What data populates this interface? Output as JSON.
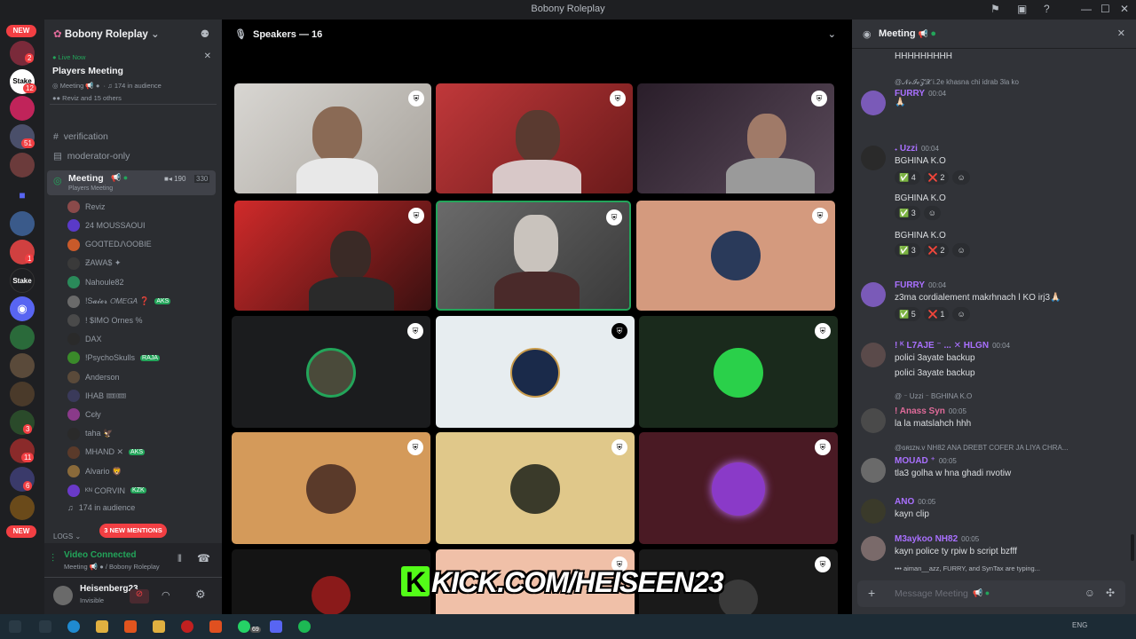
{
  "window": {
    "title": "Bobony Roleplay"
  },
  "sidebar": {
    "new_top": "NEW",
    "new_bottom": "NEW",
    "badges": [
      "2",
      "12",
      "51",
      "1",
      "3",
      "11",
      "6"
    ]
  },
  "guild": {
    "name": "Bobony Roleplay"
  },
  "live": {
    "status": "Live Now",
    "title": "Players Meeting",
    "channel": "Meeting",
    "audience": "174 in audience",
    "others": "Reviz and 15 others"
  },
  "channels": {
    "verification": "verification",
    "moderator_only": "moderator-only",
    "meeting": "Meeting",
    "meeting_sub": "Players Meeting",
    "count_a": "190",
    "count_b": "330",
    "logs": "LOGS",
    "mentions": "3 NEW MENTIONS",
    "audience": "174 in audience"
  },
  "voice_users": [
    {
      "name": "Reviz",
      "tag": ""
    },
    {
      "name": "24 MOUSSAOUI",
      "tag": ""
    },
    {
      "name": "GOⱭTEDᏁOOBIE",
      "tag": ""
    },
    {
      "name": "ƵAWA$ ✦",
      "tag": ""
    },
    {
      "name": "Nahoule82",
      "tag": ""
    },
    {
      "name": "!S𝓪𝓲𝓮𝓻 𝘖𝘔𝘌𝘎𝘈 ❓",
      "tag": "AKS"
    },
    {
      "name": "! $IMO Ornes %",
      "tag": ""
    },
    {
      "name": "DAX",
      "tag": ""
    },
    {
      "name": "!PsychoSkulls",
      "tag": "RAJA"
    },
    {
      "name": "Anderson",
      "tag": ""
    },
    {
      "name": "IHAB 🎟🎟",
      "tag": ""
    },
    {
      "name": "Cєły",
      "tag": ""
    },
    {
      "name": "taha 🦅",
      "tag": ""
    },
    {
      "name": "MHAND ✕",
      "tag": "AKS"
    },
    {
      "name": "Alvario 🦁",
      "tag": ""
    },
    {
      "name": "ᴷᴺ CORVIN",
      "tag": "KZK"
    }
  ],
  "voice_panel": {
    "status": "Video Connected",
    "location": "Meeting",
    "guild": "/ Bobony Roleplay"
  },
  "user": {
    "name": "Heisenberg23",
    "status": "Invisible"
  },
  "speakers": {
    "label": "Speakers — 16"
  },
  "colors": {
    "accent": "#5865f2",
    "green": "#23a55a",
    "red": "#f23f43",
    "kick": "#53fc18"
  },
  "chat": {
    "title": "Meeting",
    "composer_placeholder": "Message Meeting",
    "typing": "aiman__azz, FURRY, and SynTax are typing...",
    "top_text": "HHHHHHHHH",
    "messages": [
      {
        "reply": "@𝓝𝓸𝓘𝓸𝓩𝓧  i.2e  khasna chi idrab 3la ko",
        "name": "FURRY",
        "time": "00:04",
        "color": "#a970ff",
        "text": "🙏🏻",
        "reacts": []
      },
      {
        "reply": "",
        "name": "𝆺 Uzzi",
        "time": "00:04",
        "color": "#a970ff",
        "text": "BGHINA K.O",
        "reacts": [
          "✅ 4",
          "❌ 2",
          "☺"
        ]
      },
      {
        "reply": "",
        "name": "",
        "time": "",
        "color": "",
        "text": "BGHINA K.O",
        "reacts": [
          "✅ 3",
          "☺"
        ]
      },
      {
        "reply": "",
        "name": "",
        "time": "",
        "color": "",
        "text": "BGHINA K.O",
        "reacts": [
          "✅ 3",
          "❌ 2",
          "☺"
        ]
      },
      {
        "reply": "",
        "name": "FURRY",
        "time": "00:04",
        "color": "#a970ff",
        "text": "z3ma cordialement makrhnach l KO irj3🙏🏻",
        "reacts": [
          "✅ 5",
          "❌ 1",
          "☺"
        ]
      },
      {
        "reply": "",
        "name": "! ᴷ L7AJE ⁻ ... ✕  HLGN",
        "time": "00:04",
        "color": "#a970ff",
        "text": "polici 3ayate backup",
        "text2": "polici 3ayate backup",
        "reacts": []
      },
      {
        "reply": "@ ⁻ Uzzi ⁻  BGHINA K.O",
        "name": "! Anass  Syn",
        "time": "00:05",
        "color": "#e06b9a",
        "text": "la la matslahch hhh",
        "reacts": []
      },
      {
        "reply": "@ɢʀɪᴢɴ.ᴠ  NH82  ANA DREBT COFER JA LIYA CHRA...",
        "name": "MOUAD ⁺",
        "time": "00:05",
        "color": "#a970ff",
        "text": "tla3 golha w hna ghadi nvotiw",
        "reacts": []
      },
      {
        "reply": "",
        "name": "ANO",
        "time": "00:05",
        "color": "#a970ff",
        "text": "kayn clip",
        "reacts": []
      },
      {
        "reply": "",
        "name": "M3aykoo  NH82",
        "time": "00:05",
        "color": "#a970ff",
        "text": "kayn police ty rpiw b script bzfff",
        "reacts": []
      }
    ]
  },
  "overlay": {
    "kick_text": "KICK.COM/HEISEEN23",
    "kick_letter": "K"
  },
  "taskbar": {
    "badge": "69",
    "lang": "ENG"
  }
}
